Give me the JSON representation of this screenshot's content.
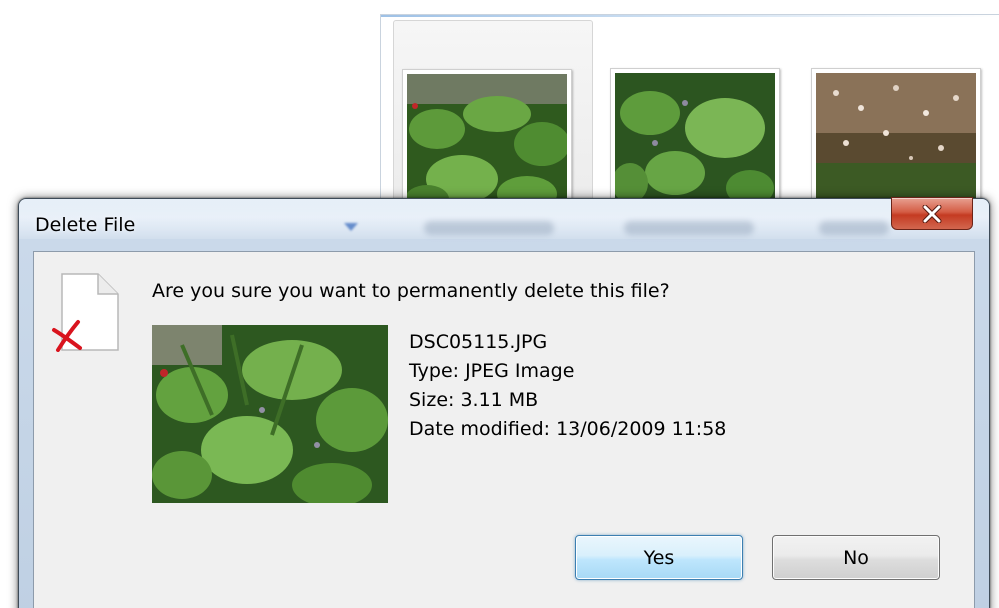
{
  "dialog": {
    "title": "Delete File",
    "question": "Are you sure you want to permanently delete this file?",
    "file": {
      "name": "DSC05115.JPG",
      "type": "Type: JPEG Image",
      "size": "Size: 3.11 MB",
      "date_modified": "Date modified: 13/06/2009 11:58"
    },
    "buttons": {
      "yes": "Yes",
      "no": "No"
    },
    "icons": {
      "close": "close-icon",
      "file": "file-delete-icon"
    }
  },
  "explorer": {
    "thumbnails": [
      {
        "selected": true
      },
      {
        "selected": false
      },
      {
        "selected": false
      }
    ]
  },
  "colors": {
    "dialog_frame": "#c9dcf0",
    "content_bg": "#f0f0f0",
    "close_button": "#c43b22",
    "yes_button_border": "#3c7fb1",
    "delete_mark": "#d9141e"
  }
}
